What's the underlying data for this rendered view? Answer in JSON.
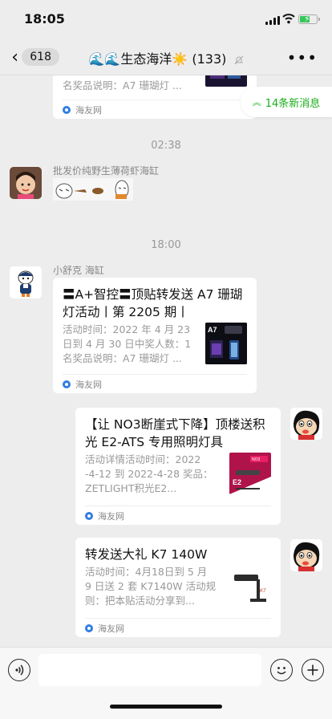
{
  "status": {
    "time": "18:05"
  },
  "nav": {
    "back_count": "618",
    "title_emoji_left": "🌊🌊",
    "title_name": "生态海洋",
    "title_emoji_sun": "☀️",
    "member_count": "(133)"
  },
  "new_messages": "14条新消息",
  "messages": {
    "top_card": {
      "desc_line": "名奖品说明：A7 珊瑚灯 ...",
      "source": "海友网"
    },
    "time1": "02:38",
    "m1": {
      "sender": "批发价纯野生薄荷虾海缸"
    },
    "time2": "18:00",
    "m2": {
      "sender": "小舒克 海缸",
      "title": "〓A+智控〓顶贴转发送 A7 珊瑚灯活动丨第 2205 期丨",
      "desc": "活动时间：2022 年 4 月 23 日到 4 月 30 日中奖人数：1 名奖品说明：A7 珊瑚灯 ...",
      "source": "海友网"
    },
    "m3": {
      "title": "【让 NO3断崖式下降】顶楼送积光 E2-ATS 专用照明灯具",
      "desc": "活动详情活动时间：2022 -4-12 到 2022-4-28 奖品：ZETLIGHT积光E2...",
      "source": "海友网"
    },
    "m4": {
      "title": "转发送大礼 K7 140W",
      "desc": "活动时间：4月18日到 5 月 9 日送 2 套 K7140W 活动规则：把本贴活动分享到...",
      "source": "海友网"
    }
  },
  "icons": {
    "back": "chevron-left-icon",
    "mute": "bell-off-icon",
    "more": "ellipsis-icon",
    "voice": "voice-icon",
    "emoji": "emoji-icon",
    "plus": "plus-icon"
  },
  "colors": {
    "accent_green": "#1aad19",
    "background": "#ededed"
  }
}
